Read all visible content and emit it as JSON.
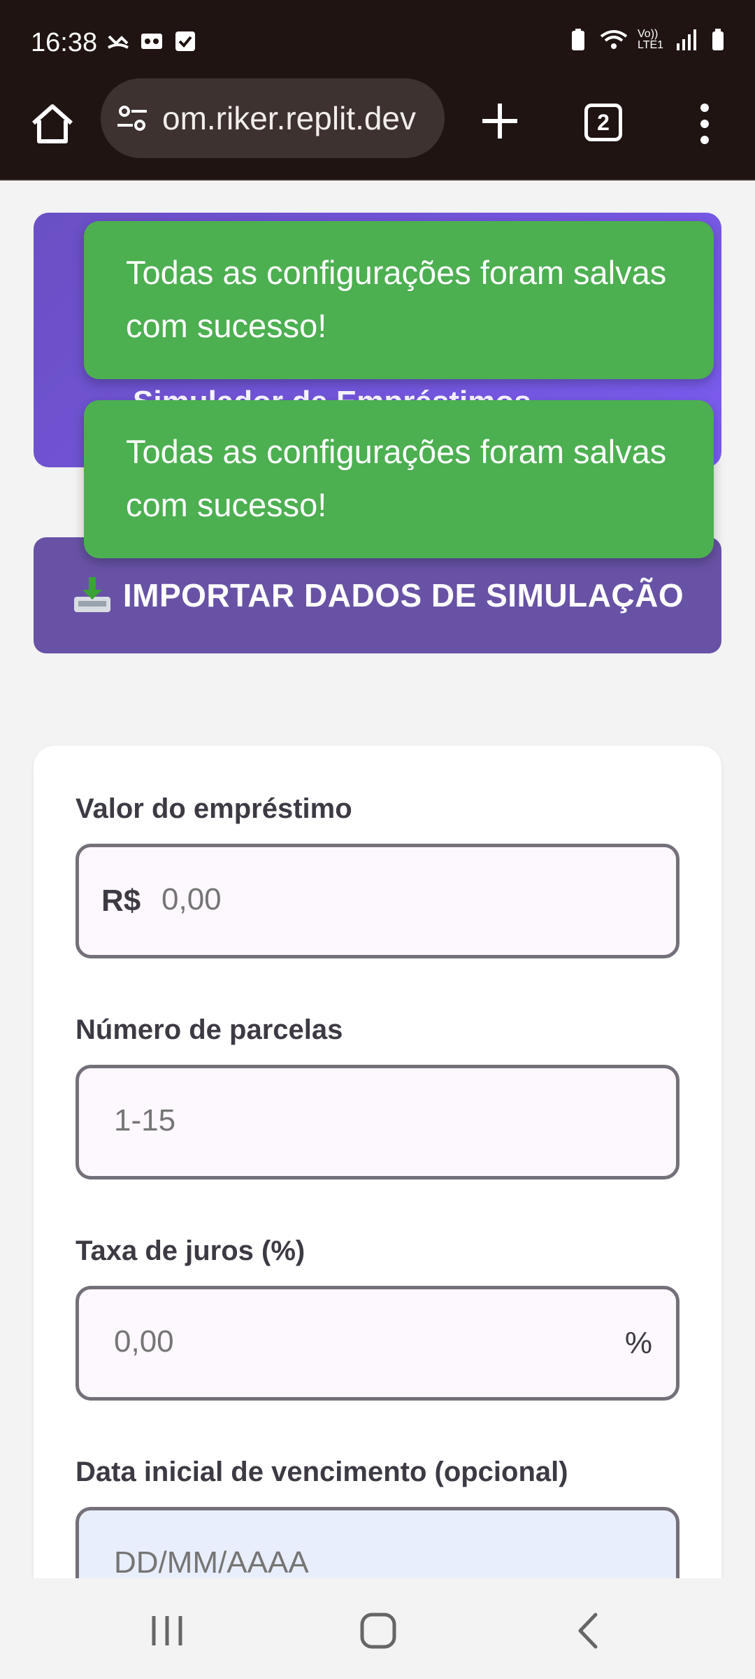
{
  "status_bar": {
    "time": "16:38",
    "network_label": "Vo)) LTE1"
  },
  "browser": {
    "url_text": "om.riker.replit.dev",
    "tab_count": "2"
  },
  "hero": {
    "title": "Simulador de Empréstimos"
  },
  "toasts": [
    {
      "message": "Todas as configurações foram salvas com sucesso!"
    },
    {
      "message": "Todas as configurações foram salvas com sucesso!"
    }
  ],
  "import_button": {
    "label": "IMPORTAR DADOS DE SIMULAÇÃO",
    "icon": "download-tray-icon"
  },
  "form": {
    "loan_amount": {
      "label": "Valor do empréstimo",
      "prefix": "R$",
      "placeholder": "0,00",
      "value": ""
    },
    "installments": {
      "label": "Número de parcelas",
      "placeholder": "1-15",
      "value": ""
    },
    "interest": {
      "label": "Taxa de juros (%)",
      "placeholder": "0,00",
      "suffix": "%",
      "value": ""
    },
    "due_date": {
      "label": "Data inicial de vencimento (opcional)",
      "placeholder": "DD/MM/AAAA",
      "value": ""
    }
  },
  "colors": {
    "toast_bg": "#4caf50",
    "hero_bg": "#7b5cf0",
    "import_btn_bg": "#6852a6",
    "browser_bar_bg": "#1f1412"
  }
}
